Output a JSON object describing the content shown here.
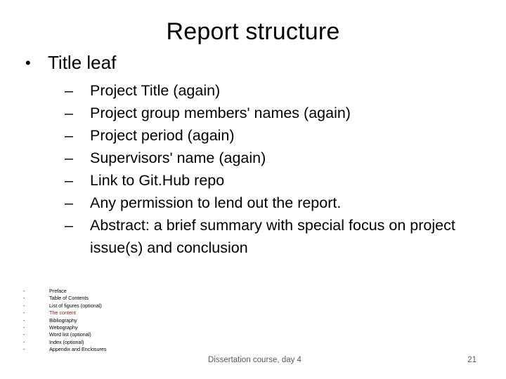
{
  "slide": {
    "title": "Report structure",
    "main_bullet": {
      "marker": "•",
      "text": "Title leaf"
    },
    "sub_bullets": [
      {
        "marker": "–",
        "text": "Project Title (again)"
      },
      {
        "marker": "–",
        "text": "Project group members' names (again)"
      },
      {
        "marker": "–",
        "text": "Project period (again)"
      },
      {
        "marker": "–",
        "text": "Supervisors' name (again)"
      },
      {
        "marker": "–",
        "text": "Link to Git.Hub repo"
      },
      {
        "marker": "–",
        "text": "Any permission to lend out the report."
      },
      {
        "marker": "–",
        "text": "Abstract: a brief summary with special focus on project issue(s) and conclusion"
      }
    ],
    "outline_items": [
      {
        "marker": "-",
        "text": "Preface",
        "highlight": false
      },
      {
        "marker": "-",
        "text": "Table of Contents",
        "highlight": false
      },
      {
        "marker": "-",
        "text": "List of figures (optional)",
        "highlight": false
      },
      {
        "marker": "-",
        "text": "The content",
        "highlight": true
      },
      {
        "marker": "-",
        "text": "Bibliography",
        "highlight": false
      },
      {
        "marker": "-",
        "text": "Webography",
        "highlight": false
      },
      {
        "marker": "-",
        "text": "Word list (optional)",
        "highlight": false
      },
      {
        "marker": "-",
        "text": "Index (optional)",
        "highlight": false
      },
      {
        "marker": "-",
        "text": "Appendix and Enclosures",
        "highlight": false
      }
    ],
    "highlight_color": "#8b1a1a",
    "footer": "Dissertation course, day 4",
    "page_number": "21"
  }
}
